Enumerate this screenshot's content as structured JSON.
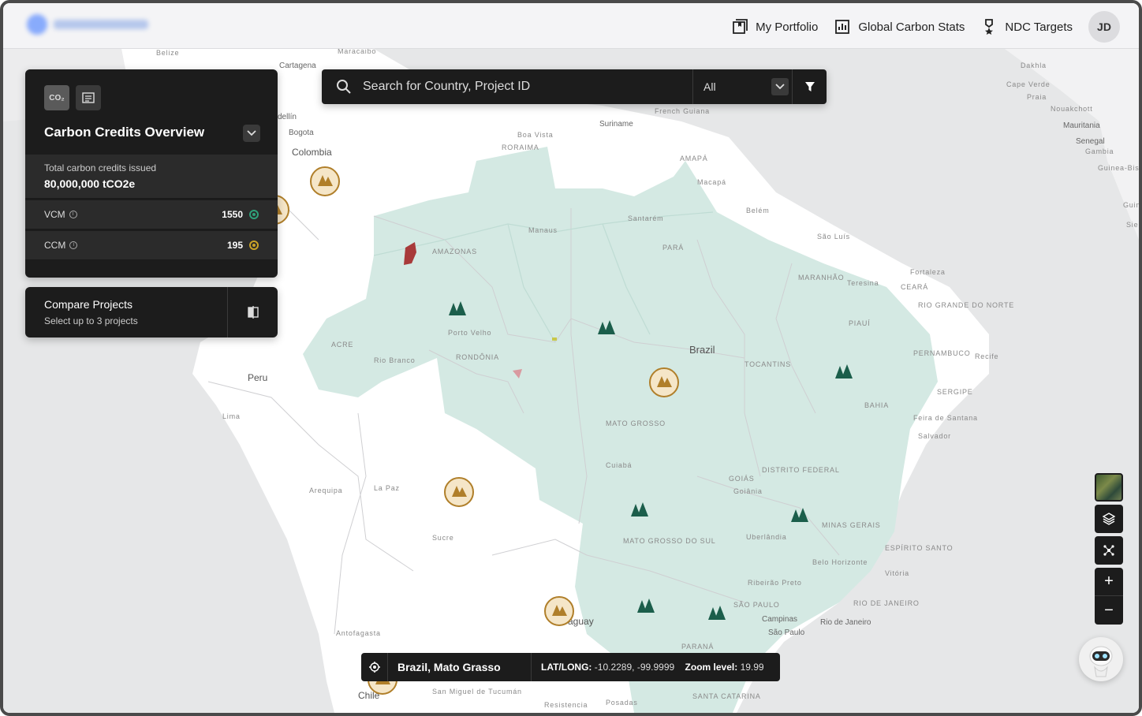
{
  "header": {
    "nav": [
      {
        "label": "My Portfolio",
        "icon": "portfolio-icon"
      },
      {
        "label": "Global Carbon Stats",
        "icon": "chart-icon"
      },
      {
        "label": "NDC Targets",
        "icon": "medal-icon"
      }
    ],
    "avatar": "JD"
  },
  "overview": {
    "icon_co2": "CO₂",
    "title": "Carbon Credits Overview",
    "total_label": "Total carbon credits issued",
    "total_value": "80,000,000 tCO2e",
    "rows": [
      {
        "label": "VCM",
        "count": "1550",
        "color": "#2fa07a"
      },
      {
        "label": "CCM",
        "count": "195",
        "color": "#c9a227"
      }
    ]
  },
  "compare": {
    "title": "Compare Projects",
    "subtitle": "Select up to 3 projects"
  },
  "search": {
    "placeholder": "Search for Country, Project ID",
    "filter_value": "All"
  },
  "location": {
    "name": "Brazil, Mato Grasso",
    "latlong_label": "LAT/LONG:",
    "latlong_value": "-10.2289, -99.9999",
    "zoom_label": "Zoom level:",
    "zoom_value": "19.99"
  },
  "map": {
    "labels": {
      "belize": "Belize",
      "maracaibo": "Maracaibo",
      "cartagena": "Cartagena",
      "medellin": "dellín",
      "bogota": "Bogota",
      "colombia": "Colombia",
      "suriname": "Suriname",
      "french_guiana": "French Guiana",
      "boa_vista": "Boa Vista",
      "roraima": "RORAIMA",
      "amapa": "AMAPÁ",
      "macapa": "Macapá",
      "belem": "Belém",
      "santarem": "Santarém",
      "manaus": "Manaus",
      "amazonas": "AMAZONAS",
      "para": "PARÁ",
      "sao_luis": "São Luís",
      "fortaleza": "Fortaleza",
      "maranhao": "MARANHÃO",
      "teresina": "Teresina",
      "ceara": "CEARÁ",
      "rio_grande_do_norte": "RIO GRANDE DO NORTE",
      "piaui": "PIAUÍ",
      "pernambuco": "PERNAMBUCO",
      "recife": "Recife",
      "sergipe": "SERGIPE",
      "bahia": "BAHIA",
      "feira": "Feira de Santana",
      "salvador": "Salvador",
      "tocantins": "TOCANTINS",
      "brazil": "Brazil",
      "porto_velho": "Porto Velho",
      "acre": "ACRE",
      "rio_branco": "Rio Branco",
      "rondonia": "RONDÔNIA",
      "mato_grosso": "MATO GROSSO",
      "cuiaba": "Cuiabá",
      "goias": "GOIÁS",
      "distrito_federal": "DISTRITO FEDERAL",
      "goiania": "Goiânia",
      "minas_gerais": "MINAS GERAIS",
      "uberlandia": "Uberlândia",
      "belo_horizonte": "Belo Horizonte",
      "espirito_santo": "ESPÍRITO SANTO",
      "vitoria": "Vitória",
      "ribeirao": "Ribeirão Preto",
      "sao_paulo_state": "SÃO PAULO",
      "campinas": "Campinas",
      "sao_paulo": "São Paulo",
      "rio_state": "RIO DE JANEIRO",
      "rio": "Rio de Janeiro",
      "mato_grosso_do_sul": "MATO GROSSO DO SUL",
      "parana": "PARANÁ",
      "santa_catarina": "SANTA CATARINA",
      "peru": "Peru",
      "lima": "Lima",
      "arequipa": "Arequipa",
      "la_paz": "La Paz",
      "sucre": "Sucre",
      "paraguay": "aguay",
      "antofagasta": "Antofagasta",
      "chile": "Chile",
      "san_miguel": "San Miguel de Tucumán",
      "resistencia": "Resistencia",
      "posadas": "Posadas",
      "dakhla": "Dakhla",
      "cape_verde": "Cape Verde",
      "praia": "Praia",
      "nouakchott": "Nouakchott",
      "mauritania": "Mauritania",
      "senegal": "Senegal",
      "gambia": "Gambia",
      "guinea_bissau": "Guinea-Bissau",
      "guinea": "Guine",
      "sierra": "Sierra"
    }
  },
  "colors": {
    "brazil_fill": "#d4e9e3",
    "vcm": "#1b5e4b",
    "ccm": "#b07f2a",
    "panel": "#1c1c1c"
  }
}
